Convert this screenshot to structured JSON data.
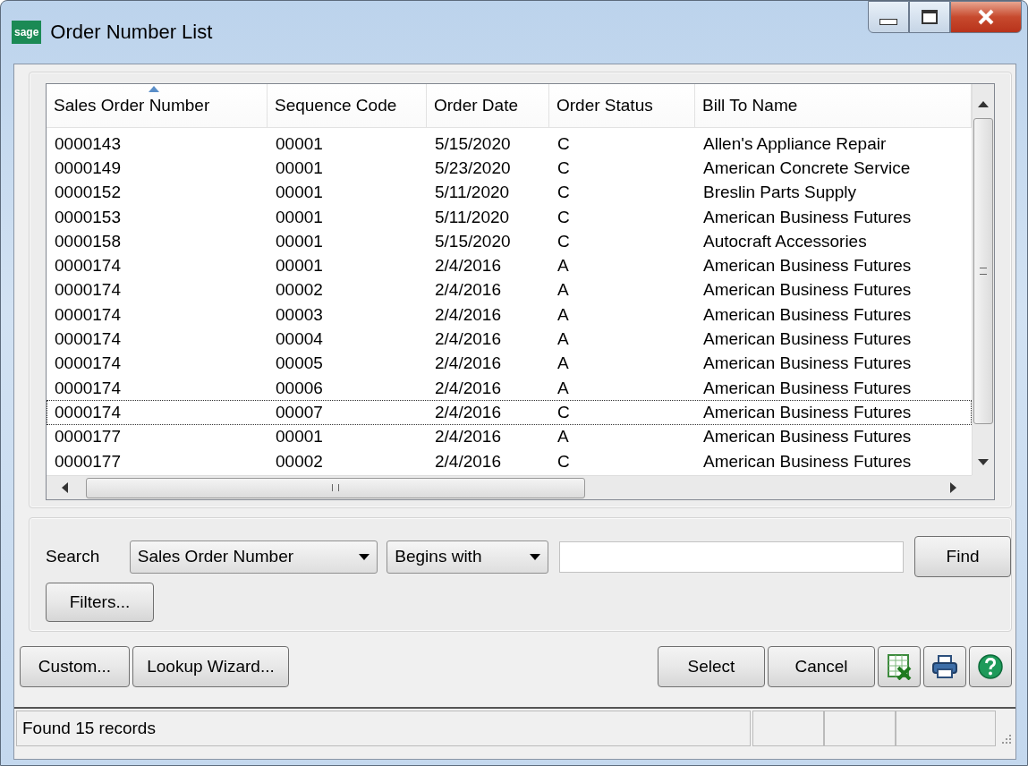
{
  "window": {
    "title": "Order Number List",
    "logo": "sage"
  },
  "table": {
    "columns": [
      {
        "label": "Sales Order Number",
        "sorted": true
      },
      {
        "label": "Sequence Code",
        "sorted": false
      },
      {
        "label": "Order Date",
        "sorted": false
      },
      {
        "label": "Order Status",
        "sorted": false
      },
      {
        "label": "Bill To Name",
        "sorted": false
      }
    ],
    "rows": [
      {
        "cells": [
          "0000143",
          "00001",
          "5/15/2020",
          "C",
          "Allen's Appliance Repair"
        ],
        "selected": false
      },
      {
        "cells": [
          "0000149",
          "00001",
          "5/23/2020",
          "C",
          "American Concrete Service"
        ],
        "selected": false
      },
      {
        "cells": [
          "0000152",
          "00001",
          "5/11/2020",
          "C",
          "Breslin Parts Supply"
        ],
        "selected": false
      },
      {
        "cells": [
          "0000153",
          "00001",
          "5/11/2020",
          "C",
          "American Business Futures"
        ],
        "selected": false
      },
      {
        "cells": [
          "0000158",
          "00001",
          "5/15/2020",
          "C",
          "Autocraft Accessories"
        ],
        "selected": false
      },
      {
        "cells": [
          "0000174",
          "00001",
          "2/4/2016",
          "A",
          "American Business Futures"
        ],
        "selected": false
      },
      {
        "cells": [
          "0000174",
          "00002",
          "2/4/2016",
          "A",
          "American Business Futures"
        ],
        "selected": false
      },
      {
        "cells": [
          "0000174",
          "00003",
          "2/4/2016",
          "A",
          "American Business Futures"
        ],
        "selected": false
      },
      {
        "cells": [
          "0000174",
          "00004",
          "2/4/2016",
          "A",
          "American Business Futures"
        ],
        "selected": false
      },
      {
        "cells": [
          "0000174",
          "00005",
          "2/4/2016",
          "A",
          "American Business Futures"
        ],
        "selected": false
      },
      {
        "cells": [
          "0000174",
          "00006",
          "2/4/2016",
          "A",
          "American Business Futures"
        ],
        "selected": false
      },
      {
        "cells": [
          "0000174",
          "00007",
          "2/4/2016",
          "C",
          "American Business Futures"
        ],
        "selected": true
      },
      {
        "cells": [
          "0000177",
          "00001",
          "2/4/2016",
          "A",
          "American Business Futures"
        ],
        "selected": false
      },
      {
        "cells": [
          "0000177",
          "00002",
          "2/4/2016",
          "C",
          "American Business Futures"
        ],
        "selected": false
      }
    ]
  },
  "search": {
    "label": "Search",
    "field": "Sales Order Number",
    "operator": "Begins with",
    "find": "Find",
    "filters": "Filters..."
  },
  "buttons": {
    "custom": "Custom...",
    "wizard": "Lookup Wizard...",
    "select": "Select",
    "cancel": "Cancel"
  },
  "status_bar": {
    "text": "Found 15 records"
  }
}
